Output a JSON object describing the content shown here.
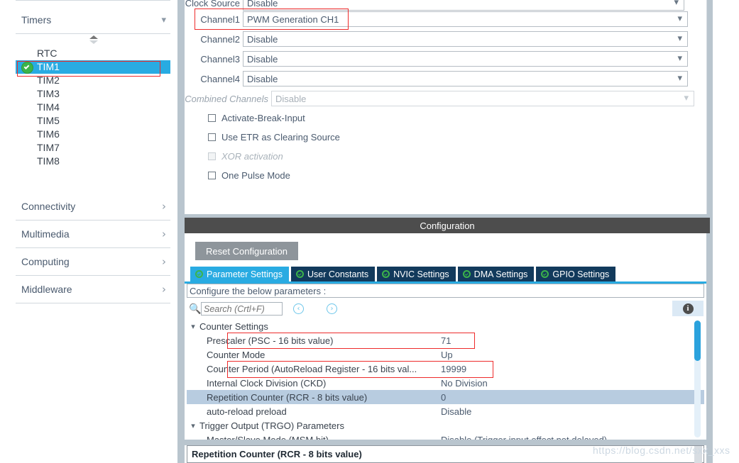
{
  "sidebar": {
    "timers_group": {
      "label": "Timers",
      "chevron": "chevron-down"
    },
    "peripherals": [
      {
        "label": "RTC",
        "selected": false
      },
      {
        "label": "TIM1",
        "selected": true
      },
      {
        "label": "TIM2",
        "selected": false
      },
      {
        "label": "TIM3",
        "selected": false
      },
      {
        "label": "TIM4",
        "selected": false
      },
      {
        "label": "TIM5",
        "selected": false
      },
      {
        "label": "TIM6",
        "selected": false
      },
      {
        "label": "TIM7",
        "selected": false
      },
      {
        "label": "TIM8",
        "selected": false
      }
    ],
    "categories": [
      {
        "label": "Connectivity",
        "chevron": "chevron-right"
      },
      {
        "label": "Multimedia",
        "chevron": "chevron-right"
      },
      {
        "label": "Computing",
        "chevron": "chevron-right"
      },
      {
        "label": "Middleware",
        "chevron": "chevron-right"
      }
    ]
  },
  "mode": {
    "rows": [
      {
        "label": "Clock Source",
        "value": "Disable",
        "disabled": false
      },
      {
        "label": "Channel1",
        "value": "PWM Generation CH1",
        "disabled": false
      },
      {
        "label": "Channel2",
        "value": "Disable",
        "disabled": false
      },
      {
        "label": "Channel3",
        "value": "Disable",
        "disabled": false
      },
      {
        "label": "Channel4",
        "value": "Disable",
        "disabled": false
      },
      {
        "label": "Combined Channels",
        "value": "Disable",
        "disabled": true
      }
    ],
    "checkboxes": [
      {
        "label": "Activate-Break-Input",
        "checked": false,
        "disabled": false
      },
      {
        "label": "Use ETR as Clearing Source",
        "checked": false,
        "disabled": false
      },
      {
        "label": "XOR activation",
        "checked": false,
        "disabled": true
      },
      {
        "label": "One Pulse Mode",
        "checked": false,
        "disabled": false
      }
    ]
  },
  "configuration": {
    "title": "Configuration",
    "reset_label": "Reset Configuration",
    "tabs": [
      {
        "label": "Parameter Settings",
        "active": true
      },
      {
        "label": "User Constants",
        "active": false
      },
      {
        "label": "NVIC Settings",
        "active": false
      },
      {
        "label": "DMA Settings",
        "active": false
      },
      {
        "label": "GPIO Settings",
        "active": false
      }
    ],
    "hint": "Configure the below parameters :",
    "search": {
      "placeholder": "Search (Crtl+F)",
      "value": ""
    },
    "nav_prev": "‹",
    "nav_next": "›",
    "tree": [
      {
        "kind": "group",
        "name": "Counter Settings",
        "expanded": true
      },
      {
        "kind": "param",
        "name": "Prescaler (PSC - 16 bits value)",
        "value": "71",
        "selected": false
      },
      {
        "kind": "param",
        "name": "Counter Mode",
        "value": "Up",
        "selected": false
      },
      {
        "kind": "param",
        "name": "Counter Period (AutoReload Register - 16 bits val...",
        "value": "19999",
        "selected": false
      },
      {
        "kind": "param",
        "name": "Internal Clock Division (CKD)",
        "value": "No Division",
        "selected": false
      },
      {
        "kind": "param",
        "name": "Repetition Counter (RCR - 8 bits value)",
        "value": "0",
        "selected": true
      },
      {
        "kind": "param",
        "name": "auto-reload preload",
        "value": "Disable",
        "selected": false
      },
      {
        "kind": "group",
        "name": "Trigger Output (TRGO) Parameters",
        "expanded": true
      },
      {
        "kind": "param",
        "name": "Master/Slave Mode (MSM bit)",
        "value": "Disable (Trigger input effect not delayed)",
        "selected": false
      }
    ],
    "detail_title": "Repetition Counter (RCR - 8 bits value)"
  },
  "watermark": "https://blog.csdn.net/sxx_xxs",
  "colors": {
    "accent_blue": "#29abe2",
    "tab_inactive": "#123a5c",
    "selection_row": "#b8cce0",
    "annotation_red": "#ee2b2b",
    "check_green": "#3cb44a",
    "panel_divider": "#b9c5ce"
  }
}
